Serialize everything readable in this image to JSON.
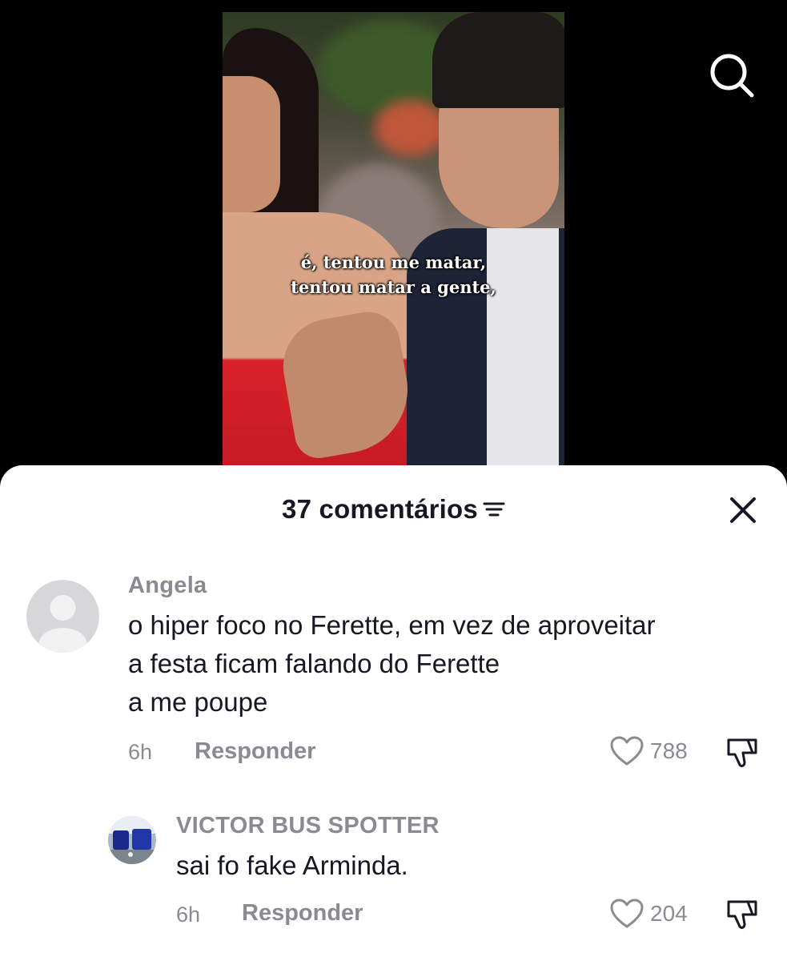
{
  "video": {
    "caption_lines": [
      "é, tentou me matar,",
      "tentou matar a gente,"
    ]
  },
  "header": {
    "comment_count_label": "37 comentários"
  },
  "icons": {
    "search": "search-icon",
    "sort": "sort-lines-icon",
    "close": "close-icon",
    "like": "heart-icon",
    "dislike": "thumbs-down-icon"
  },
  "comments": [
    {
      "username": "Angela",
      "text_lines": [
        "o hiper foco no Ferette, em vez de aproveitar",
        "a festa ficam falando do Ferette",
        "a me poupe"
      ],
      "time": "6h",
      "reply_label": "Responder",
      "likes": "788"
    },
    {
      "username": "VICTOR BUS SPOTTER",
      "text_lines": [
        "sai fo fake Arminda."
      ],
      "time": "6h",
      "reply_label": "Responder",
      "likes": "204"
    }
  ],
  "colors": {
    "sheet_bg": "#ffffff",
    "primary_text": "#161823",
    "secondary_text": "#8a8b91",
    "backdrop": "#000000"
  }
}
